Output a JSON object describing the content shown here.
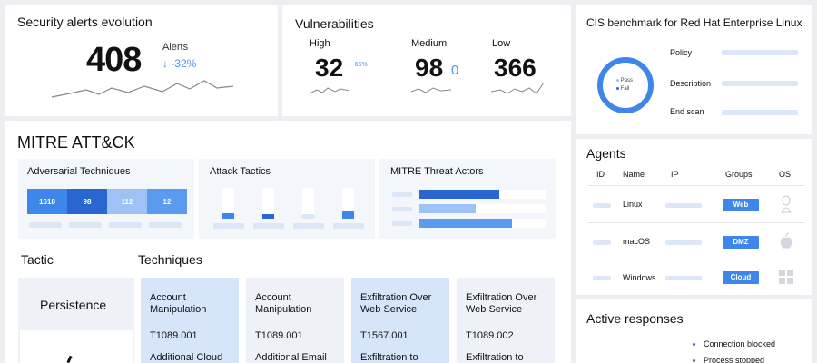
{
  "security_alerts": {
    "title": "Security alerts evolution",
    "count": "408",
    "label": "Alerts",
    "change": "↓ -32%"
  },
  "vulnerabilities": {
    "title": "Vulnerabilities",
    "high": {
      "label": "High",
      "value": "32",
      "change": "↓ -65%"
    },
    "medium": {
      "label": "Medium",
      "value": "98",
      "extra": "0"
    },
    "low": {
      "label": "Low",
      "value": "366"
    }
  },
  "cis": {
    "title": "CIS benchmark for Red Hat Enterprise Linux",
    "legend_pass": "Pass",
    "legend_fail": "Fail",
    "fields": [
      "Policy",
      "Description",
      "End scan"
    ]
  },
  "mitre": {
    "title": "MITRE ATT&CK",
    "adversarial": {
      "title": "Adversarial Techniques",
      "values": [
        "1618",
        "98",
        "112",
        "12"
      ],
      "colors": [
        "#3e86ea",
        "#2a66cf",
        "#9ec2f5",
        "#5a9bef"
      ]
    },
    "tactics": {
      "title": "Attack Tactics"
    },
    "actors": {
      "title": "MITRE Threat Actors"
    },
    "tactic_header": "Tactic",
    "techniques_header": "Techniques",
    "tactic_name": "Persistence",
    "techniques": [
      {
        "name": "Account Manipulation",
        "id": "T1089.001",
        "sub": "Additional Cloud"
      },
      {
        "name": "Account Manipulation",
        "id": "T1089.001",
        "sub": "Additional Email"
      },
      {
        "name": "Exfiltration Over Web Service",
        "id": "T1567.001",
        "sub": "Exfiltration to"
      },
      {
        "name": "Exfiltration Over Web Service",
        "id": "T1089.002",
        "sub": "Exfiltration to"
      }
    ]
  },
  "agents": {
    "title": "Agents",
    "columns": [
      "ID",
      "Name",
      "IP",
      "Groups",
      "OS"
    ],
    "rows": [
      {
        "name": "Linux",
        "group": "Web",
        "os": "linux-icon"
      },
      {
        "name": "macOS",
        "group": "DMZ",
        "os": "apple-icon"
      },
      {
        "name": "Windows",
        "group": "Cloud",
        "os": "windows-icon"
      }
    ]
  },
  "active_responses": {
    "title": "Active responses",
    "items": [
      "Connection blocked",
      "Process stopped"
    ]
  },
  "colors": {
    "accent": "#3e86ea",
    "accent_dark": "#2a66cf",
    "accent_light": "#dbe6f6"
  }
}
